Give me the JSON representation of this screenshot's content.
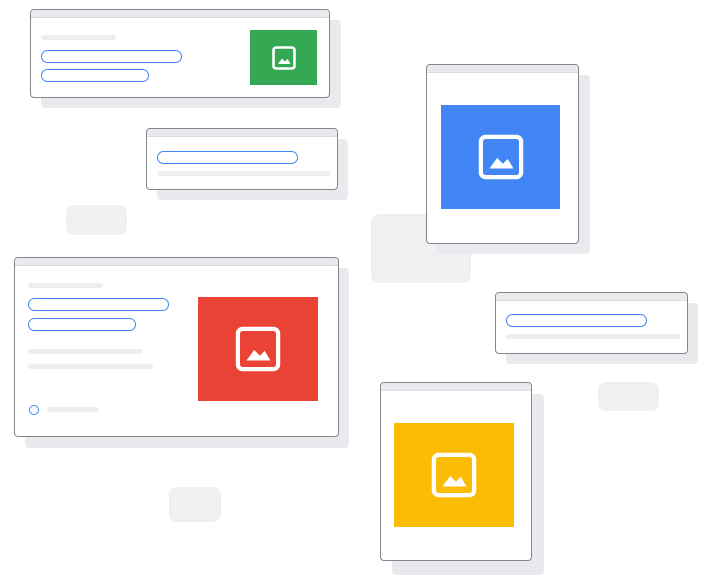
{
  "colors": {
    "green": "#34a853",
    "blue": "#4285f4",
    "red": "#ea4335",
    "yellow": "#fbbc04",
    "card_border": "#80868b",
    "shadow": "#e8eaed",
    "input_outline": "#4285f4"
  },
  "icons": {
    "thumbnail": "image-placeholder-icon"
  },
  "cards": [
    {
      "name": "card-top-left",
      "thumbnail_color": "green",
      "inputs": 2
    },
    {
      "name": "card-small-center",
      "inputs": 1
    },
    {
      "name": "card-tall-blue",
      "thumbnail_color": "blue"
    },
    {
      "name": "card-large-left",
      "thumbnail_color": "red",
      "inputs": 2,
      "radio": 1
    },
    {
      "name": "card-small-right",
      "inputs": 1
    },
    {
      "name": "card-tall-yellow",
      "thumbnail_color": "yellow"
    }
  ]
}
